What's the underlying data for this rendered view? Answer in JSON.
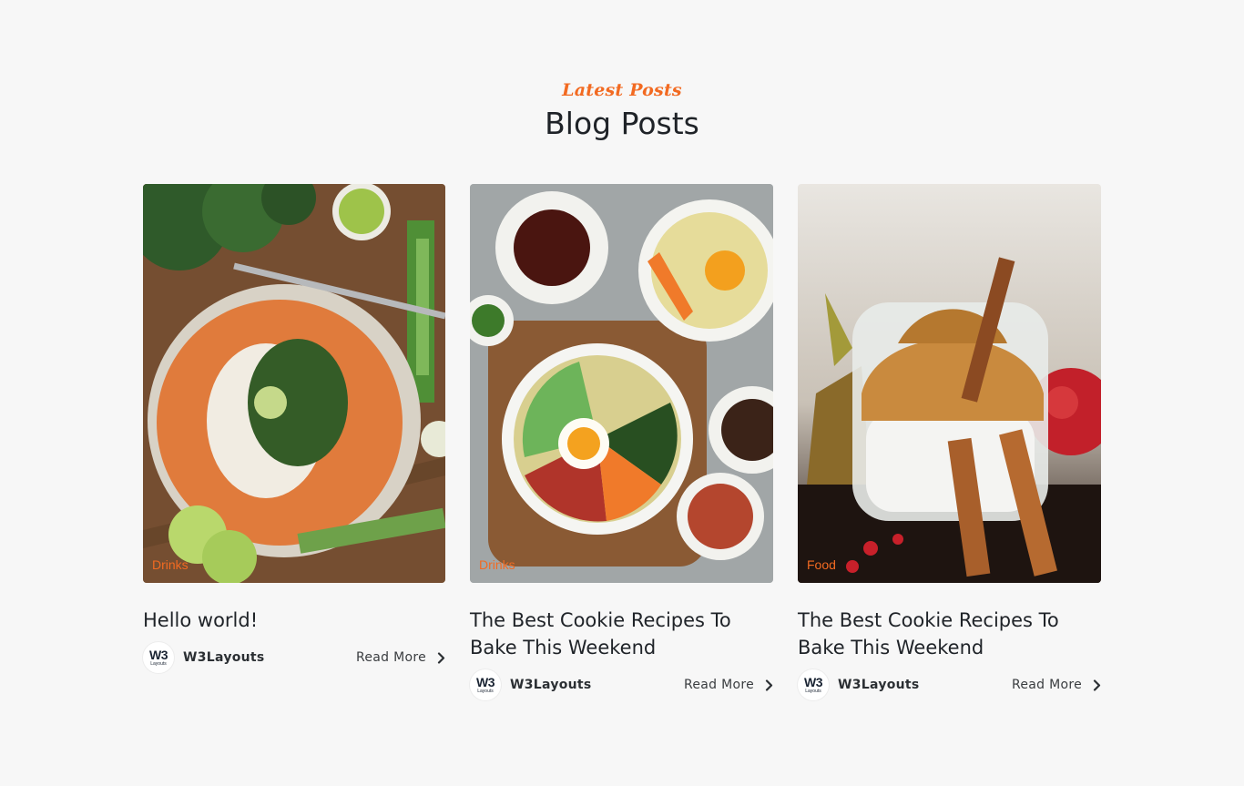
{
  "header": {
    "kicker": "Latest Posts",
    "title": "Blog Posts"
  },
  "colors": {
    "accent": "#f26a21",
    "background": "#f7f7f7",
    "text": "#1f2328"
  },
  "posts": [
    {
      "category": "Drinks",
      "title": "Hello world!",
      "author": "W3Layouts",
      "read_more": "Read More",
      "image": "curry-bowl-photo"
    },
    {
      "category": "Drinks",
      "title": "The Best Cookie Recipes To Bake This Weekend",
      "author": "W3Layouts",
      "read_more": "Read More",
      "image": "bibimbap-photo"
    },
    {
      "category": "Food",
      "title": "The Best Cookie Recipes To Bake This Weekend",
      "author": "W3Layouts",
      "read_more": "Read More",
      "image": "dalgona-coffee-photo"
    }
  ],
  "avatar": {
    "logo_main": "W3",
    "logo_sub": "Layouts"
  }
}
